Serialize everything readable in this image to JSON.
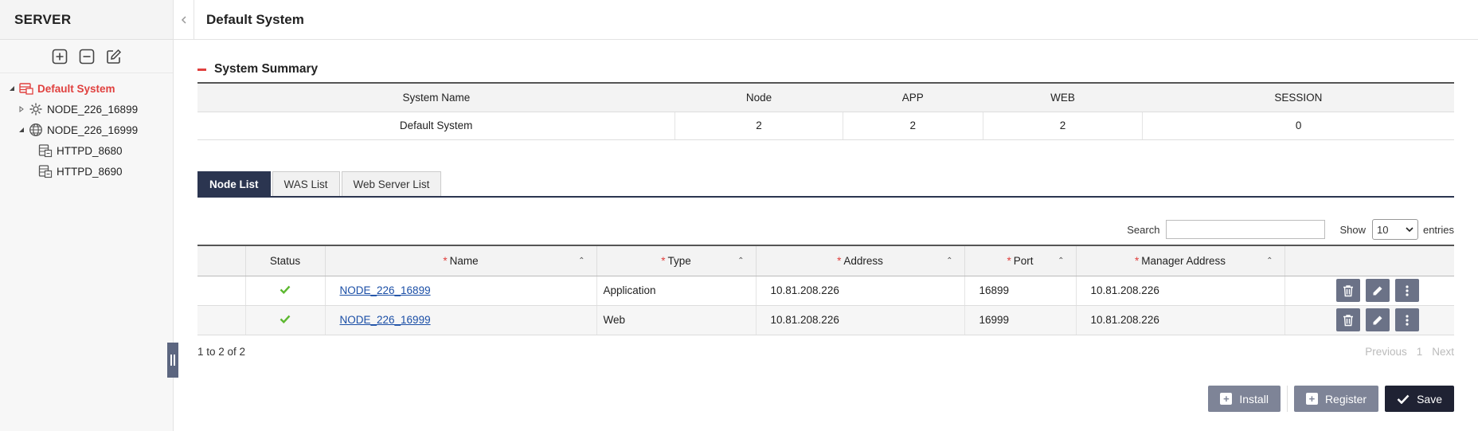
{
  "sidebar": {
    "title": "SERVER",
    "tools": [
      "plus-square-icon",
      "minus-square-icon",
      "edit-icon"
    ],
    "tree": [
      {
        "label": "Default System",
        "icon": "system-icon",
        "expanded": true,
        "active": true
      },
      {
        "label": "NODE_226_16899",
        "icon": "gear-icon",
        "expanded": false
      },
      {
        "label": "NODE_226_16999",
        "icon": "globe-icon",
        "expanded": true
      },
      {
        "label": "HTTPD_8680",
        "icon": "server-icon"
      },
      {
        "label": "HTTPD_8690",
        "icon": "server-icon"
      }
    ]
  },
  "header": {
    "title": "Default System"
  },
  "summary": {
    "title": "System Summary",
    "columns": [
      "System Name",
      "Node",
      "APP",
      "WEB",
      "SESSION"
    ],
    "row": [
      "Default System",
      "2",
      "2",
      "2",
      "0"
    ]
  },
  "tabs": [
    {
      "label": "Node List",
      "active": true
    },
    {
      "label": "WAS List",
      "active": false
    },
    {
      "label": "Web Server List",
      "active": false
    }
  ],
  "controls": {
    "search_label": "Search",
    "search_value": "",
    "show_label": "Show",
    "entries_value": "10",
    "entries_label": "entries"
  },
  "nodes": {
    "columns": {
      "status": "Status",
      "name": "Name",
      "type": "Type",
      "address": "Address",
      "port": "Port",
      "manager": "Manager Address"
    },
    "required_mark": "*",
    "rows": [
      {
        "status": "ok",
        "name": "NODE_226_16899",
        "type": "Application",
        "address": "10.81.208.226",
        "port": "16899",
        "manager": "10.81.208.226"
      },
      {
        "status": "ok",
        "name": "NODE_226_16999",
        "type": "Web",
        "address": "10.81.208.226",
        "port": "16999",
        "manager": "10.81.208.226"
      }
    ],
    "info": "1 to 2 of 2"
  },
  "pager": {
    "previous": "Previous",
    "page": "1",
    "next": "Next"
  },
  "buttons": {
    "install": "Install",
    "register": "Register",
    "save": "Save"
  },
  "colors": {
    "accent_red": "#e0403e",
    "navy": "#2b3550",
    "button_gray": "#7e8497",
    "button_dark": "#1f2233",
    "status_ok": "#5cb82f"
  }
}
